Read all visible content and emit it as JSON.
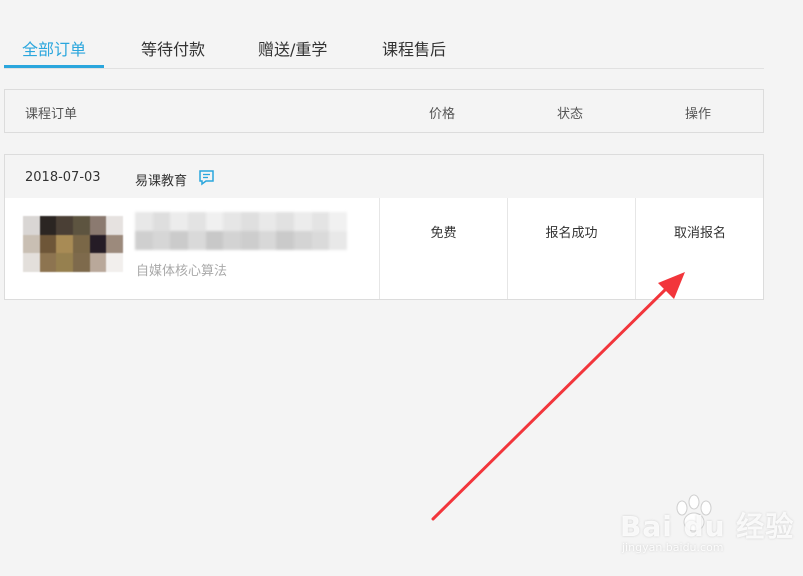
{
  "tabs": [
    {
      "label": "全部订单",
      "active": true
    },
    {
      "label": "等待付款",
      "active": false
    },
    {
      "label": "赠送/重学",
      "active": false
    },
    {
      "label": "课程售后",
      "active": false
    }
  ],
  "table_header": {
    "order": "课程订单",
    "price": "价格",
    "status": "状态",
    "action": "操作"
  },
  "order": {
    "date": "2018-07-03",
    "org": "易课教育",
    "course_subtitle": "自媒体核心算法",
    "price": "免费",
    "status": "报名成功",
    "action": "取消报名"
  },
  "watermark": {
    "brand": "Bai du 经验",
    "url": "jingyan.baidu.com"
  },
  "colors": {
    "accent": "#2aa6dd",
    "arrow": "#f2353b",
    "background": "#f4f4f4"
  }
}
